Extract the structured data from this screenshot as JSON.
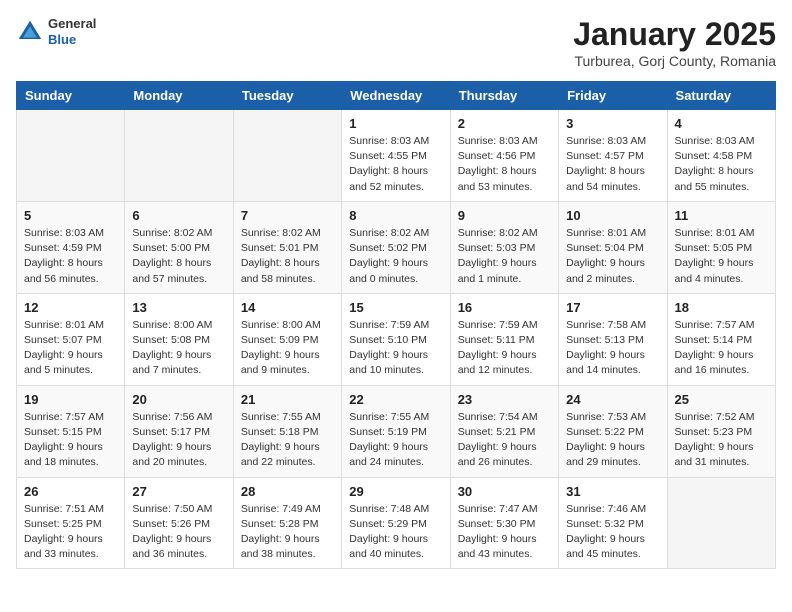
{
  "header": {
    "logo_general": "General",
    "logo_blue": "Blue",
    "month_title": "January 2025",
    "location": "Turburea, Gorj County, Romania"
  },
  "days_of_week": [
    "Sunday",
    "Monday",
    "Tuesday",
    "Wednesday",
    "Thursday",
    "Friday",
    "Saturday"
  ],
  "weeks": [
    [
      {
        "day": "",
        "info": ""
      },
      {
        "day": "",
        "info": ""
      },
      {
        "day": "",
        "info": ""
      },
      {
        "day": "1",
        "info": "Sunrise: 8:03 AM\nSunset: 4:55 PM\nDaylight: 8 hours\nand 52 minutes."
      },
      {
        "day": "2",
        "info": "Sunrise: 8:03 AM\nSunset: 4:56 PM\nDaylight: 8 hours\nand 53 minutes."
      },
      {
        "day": "3",
        "info": "Sunrise: 8:03 AM\nSunset: 4:57 PM\nDaylight: 8 hours\nand 54 minutes."
      },
      {
        "day": "4",
        "info": "Sunrise: 8:03 AM\nSunset: 4:58 PM\nDaylight: 8 hours\nand 55 minutes."
      }
    ],
    [
      {
        "day": "5",
        "info": "Sunrise: 8:03 AM\nSunset: 4:59 PM\nDaylight: 8 hours\nand 56 minutes."
      },
      {
        "day": "6",
        "info": "Sunrise: 8:02 AM\nSunset: 5:00 PM\nDaylight: 8 hours\nand 57 minutes."
      },
      {
        "day": "7",
        "info": "Sunrise: 8:02 AM\nSunset: 5:01 PM\nDaylight: 8 hours\nand 58 minutes."
      },
      {
        "day": "8",
        "info": "Sunrise: 8:02 AM\nSunset: 5:02 PM\nDaylight: 9 hours\nand 0 minutes."
      },
      {
        "day": "9",
        "info": "Sunrise: 8:02 AM\nSunset: 5:03 PM\nDaylight: 9 hours\nand 1 minute."
      },
      {
        "day": "10",
        "info": "Sunrise: 8:01 AM\nSunset: 5:04 PM\nDaylight: 9 hours\nand 2 minutes."
      },
      {
        "day": "11",
        "info": "Sunrise: 8:01 AM\nSunset: 5:05 PM\nDaylight: 9 hours\nand 4 minutes."
      }
    ],
    [
      {
        "day": "12",
        "info": "Sunrise: 8:01 AM\nSunset: 5:07 PM\nDaylight: 9 hours\nand 5 minutes."
      },
      {
        "day": "13",
        "info": "Sunrise: 8:00 AM\nSunset: 5:08 PM\nDaylight: 9 hours\nand 7 minutes."
      },
      {
        "day": "14",
        "info": "Sunrise: 8:00 AM\nSunset: 5:09 PM\nDaylight: 9 hours\nand 9 minutes."
      },
      {
        "day": "15",
        "info": "Sunrise: 7:59 AM\nSunset: 5:10 PM\nDaylight: 9 hours\nand 10 minutes."
      },
      {
        "day": "16",
        "info": "Sunrise: 7:59 AM\nSunset: 5:11 PM\nDaylight: 9 hours\nand 12 minutes."
      },
      {
        "day": "17",
        "info": "Sunrise: 7:58 AM\nSunset: 5:13 PM\nDaylight: 9 hours\nand 14 minutes."
      },
      {
        "day": "18",
        "info": "Sunrise: 7:57 AM\nSunset: 5:14 PM\nDaylight: 9 hours\nand 16 minutes."
      }
    ],
    [
      {
        "day": "19",
        "info": "Sunrise: 7:57 AM\nSunset: 5:15 PM\nDaylight: 9 hours\nand 18 minutes."
      },
      {
        "day": "20",
        "info": "Sunrise: 7:56 AM\nSunset: 5:17 PM\nDaylight: 9 hours\nand 20 minutes."
      },
      {
        "day": "21",
        "info": "Sunrise: 7:55 AM\nSunset: 5:18 PM\nDaylight: 9 hours\nand 22 minutes."
      },
      {
        "day": "22",
        "info": "Sunrise: 7:55 AM\nSunset: 5:19 PM\nDaylight: 9 hours\nand 24 minutes."
      },
      {
        "day": "23",
        "info": "Sunrise: 7:54 AM\nSunset: 5:21 PM\nDaylight: 9 hours\nand 26 minutes."
      },
      {
        "day": "24",
        "info": "Sunrise: 7:53 AM\nSunset: 5:22 PM\nDaylight: 9 hours\nand 29 minutes."
      },
      {
        "day": "25",
        "info": "Sunrise: 7:52 AM\nSunset: 5:23 PM\nDaylight: 9 hours\nand 31 minutes."
      }
    ],
    [
      {
        "day": "26",
        "info": "Sunrise: 7:51 AM\nSunset: 5:25 PM\nDaylight: 9 hours\nand 33 minutes."
      },
      {
        "day": "27",
        "info": "Sunrise: 7:50 AM\nSunset: 5:26 PM\nDaylight: 9 hours\nand 36 minutes."
      },
      {
        "day": "28",
        "info": "Sunrise: 7:49 AM\nSunset: 5:28 PM\nDaylight: 9 hours\nand 38 minutes."
      },
      {
        "day": "29",
        "info": "Sunrise: 7:48 AM\nSunset: 5:29 PM\nDaylight: 9 hours\nand 40 minutes."
      },
      {
        "day": "30",
        "info": "Sunrise: 7:47 AM\nSunset: 5:30 PM\nDaylight: 9 hours\nand 43 minutes."
      },
      {
        "day": "31",
        "info": "Sunrise: 7:46 AM\nSunset: 5:32 PM\nDaylight: 9 hours\nand 45 minutes."
      },
      {
        "day": "",
        "info": ""
      }
    ]
  ]
}
